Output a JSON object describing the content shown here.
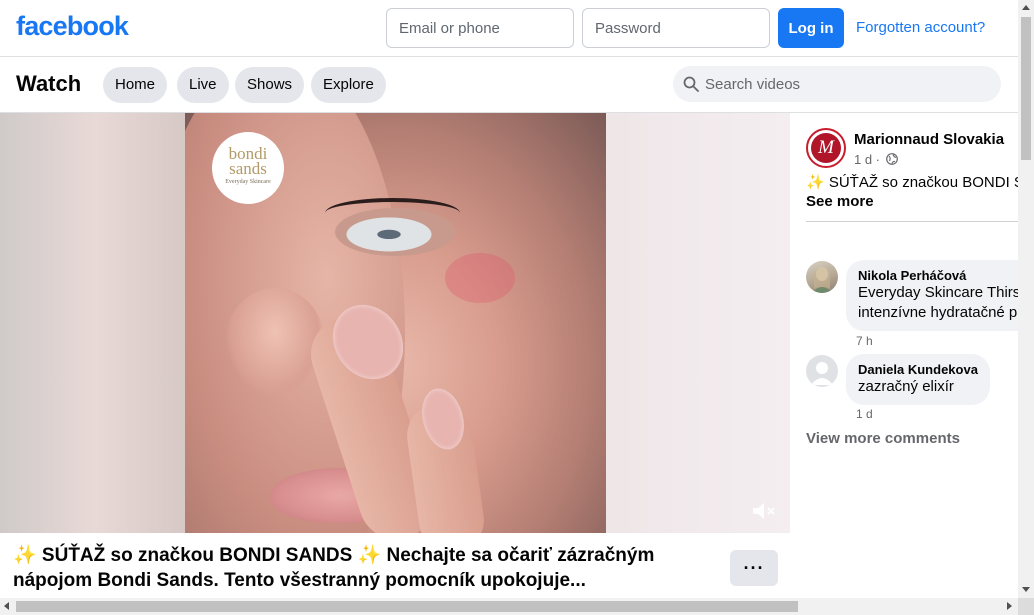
{
  "header": {
    "logo": "facebook",
    "email_placeholder": "Email or phone",
    "password_placeholder": "Password",
    "login_label": "Log in",
    "forgot_label": "Forgotten account?"
  },
  "watch": {
    "title": "Watch",
    "tabs": [
      {
        "label": "Home"
      },
      {
        "label": "Live"
      },
      {
        "label": "Shows"
      },
      {
        "label": "Explore"
      }
    ],
    "search_placeholder": "Search videos"
  },
  "video": {
    "brand_logo_name": "bondi sands",
    "brand_logo_sub": "Everyday Skincare",
    "caption_line1": "✨ SÚŤAŽ so značkou BONDI SANDS ✨ Nechajte sa očariť zázračným",
    "caption_line2": "nápojom Bondi Sands. Tento všestranný pomocník upokojuje...",
    "more_label": "···",
    "mute_icon": "speaker-muted-icon"
  },
  "post": {
    "page_name": "Marionnaud Slovakia",
    "avatar_letter": "M",
    "time": "1 d ·",
    "text": "✨ SÚŤAŽ so značkou BONDI SANDS ✨",
    "see_more": "See more"
  },
  "comments": [
    {
      "name": "Nikola Perháčová",
      "line1": "Everyday Skincare Thirsty Skin",
      "line2": "intenzívne hydratačné pleťové",
      "time": "7 h"
    },
    {
      "name": "Daniela Kundekova",
      "line1": "zazračný elixír",
      "time": "1 d"
    }
  ],
  "view_more_comments": "View more comments",
  "colors": {
    "brand_blue": "#1877f2",
    "pill_gray": "#e4e6eb",
    "search_bg": "#f0f2f5",
    "marionnaud_red": "#b0152a"
  }
}
